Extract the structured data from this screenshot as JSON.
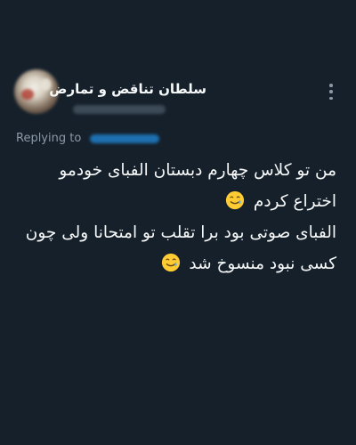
{
  "author": {
    "display_name": "سلطان تناقض و تمارض",
    "avatar_icon": "blurred-avatar"
  },
  "reply": {
    "label": "Replying to"
  },
  "tweet": {
    "lines": [
      "من تو کلاس چهارم دبستان الفبای خودمو",
      "اختراع کردم",
      "الفبای صوتی بود برا تقلب تو امتحانا ولی چون",
      "کسی نبود منسوخ شد"
    ],
    "emoji_name": "crying-smile-emoji"
  },
  "colors": {
    "background": "#15202b",
    "text": "#f7f9f9",
    "muted": "#8b98a5",
    "link": "#1d9bf0"
  }
}
